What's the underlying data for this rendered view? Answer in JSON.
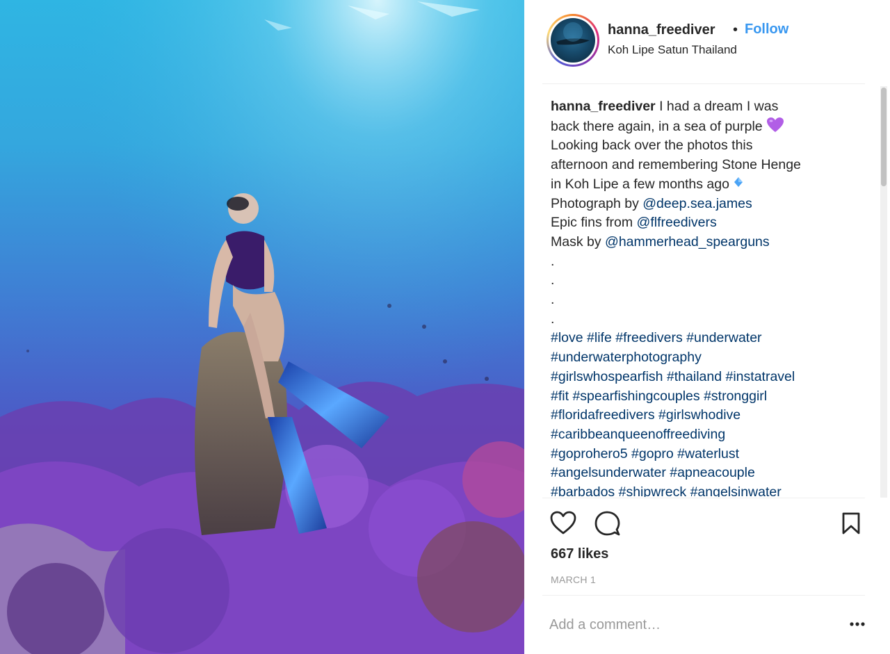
{
  "post": {
    "username": "hanna_freediver",
    "separator": "•",
    "follow_label": "Follow",
    "location": "Koh Lipe Satun Thailand"
  },
  "caption": {
    "username": "hanna_freediver",
    "line1": " I had a dream I was",
    "line2": "back there again, in a sea of purple ",
    "line3": "Looking back over the photos this",
    "line4": "afternoon and remembering Stone Henge",
    "line5": "in Koh Lipe a few months ago ",
    "credit1_text": "Photograph by ",
    "credit1_link": "@deep.sea.james",
    "credit2_text": "Epic fins from ",
    "credit2_link": "@flfreedivers",
    "credit3_text": "Mask by ",
    "credit3_link": "@hammerhead_spearguns",
    "dots": [
      ".",
      ".",
      ".",
      "."
    ],
    "hashtag_lines": [
      [
        "#love",
        "#life",
        "#freedivers",
        "#underwater"
      ],
      [
        "#underwaterphotography"
      ],
      [
        "#girlswhospearfish",
        "#thailand",
        "#instatravel"
      ],
      [
        "#fit",
        "#spearfishingcouples",
        "#stronggirl"
      ],
      [
        "#floridafreedivers",
        "#girlswhodive"
      ],
      [
        "#caribbeanqueenoffreediving"
      ],
      [
        "#goprohero5",
        "#gopro",
        "#waterlust"
      ],
      [
        "#angelsunderwater",
        "#apneacouple"
      ],
      [
        "#barbados",
        "#shipwreck",
        "#angelsinwater"
      ]
    ]
  },
  "stats": {
    "likes": "667 likes",
    "date": "MARCH 1"
  },
  "comment": {
    "placeholder": "Add a comment…"
  },
  "icons": {
    "like": "heart-icon",
    "comment": "comment-icon",
    "save": "bookmark-icon",
    "more": "more-options-icon",
    "purple_heart": "purple-heart-emoji",
    "diamond": "blue-diamond-emoji"
  },
  "colors": {
    "link": "#003569",
    "follow": "#3897f0",
    "text": "#262626",
    "muted": "#999999"
  }
}
